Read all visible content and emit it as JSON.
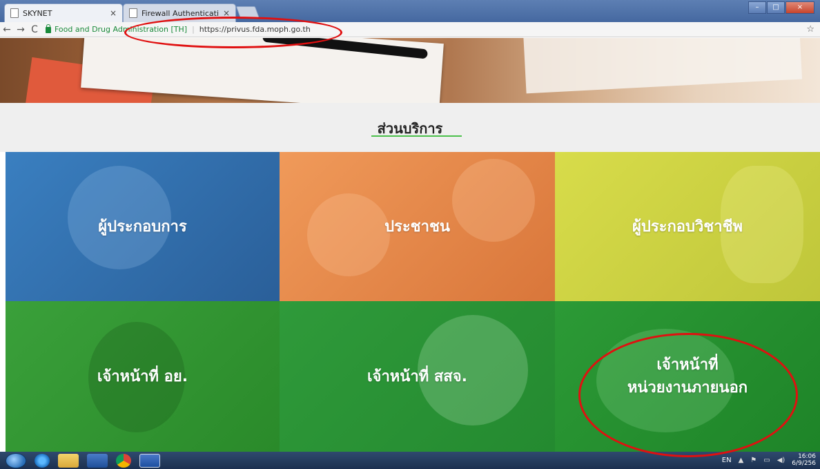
{
  "browser": {
    "tabs": [
      {
        "title": "SKYNET",
        "active": true
      },
      {
        "title": "Firewall Authentication K",
        "active": false
      }
    ],
    "address": {
      "site_name": "Food and Drug Administration [TH]",
      "url": "https://privus.fda.moph.go.th"
    },
    "window_controls": [
      "minimize",
      "maximize",
      "close"
    ]
  },
  "page": {
    "section_title": "ส่วนบริการ",
    "tiles": [
      {
        "label": "ผู้ประกอบการ",
        "color": "#3a7fc0"
      },
      {
        "label": "ประชาชน",
        "color": "#f09a5a"
      },
      {
        "label": "ผู้ประกอบวิชาชีพ",
        "color": "#d8dc4a"
      },
      {
        "label": "เจ้าหน้าที่ อย.",
        "color": "#3aa03a"
      },
      {
        "label": "เจ้าหน้าที่ สสจ.",
        "color": "#2f9a3a"
      },
      {
        "label_line1": "เจ้าหน้าที่",
        "label_line2": "หน่วยงานภายนอก",
        "color": "#2c9a36"
      }
    ],
    "annotation_color": "#e01010"
  },
  "taskbar": {
    "apps": [
      "internet-explorer-icon",
      "file-explorer-icon",
      "media-player-icon",
      "chrome-icon",
      "word-icon"
    ],
    "tray": {
      "language": "EN",
      "time": "16:06",
      "date": "6/9/256"
    }
  }
}
